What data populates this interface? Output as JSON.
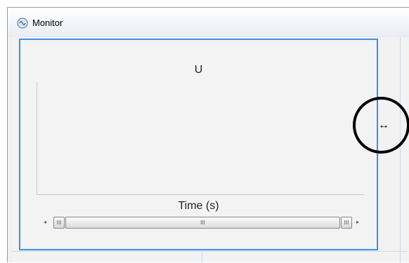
{
  "window": {
    "title": "Monitor",
    "icon": "monitor-icon"
  },
  "plot": {
    "title": "U",
    "xlabel": "Time (s)",
    "ylabel": ""
  },
  "scrollbar": {
    "left_arrow": "◂",
    "right_arrow": "▸",
    "grip_glyph": "III"
  },
  "cursor": {
    "type": "horizontal-resize",
    "glyph": "↔"
  },
  "chart_data": {
    "type": "line",
    "title": "U",
    "xlabel": "Time (s)",
    "ylabel": "",
    "series": [],
    "grid": false
  }
}
